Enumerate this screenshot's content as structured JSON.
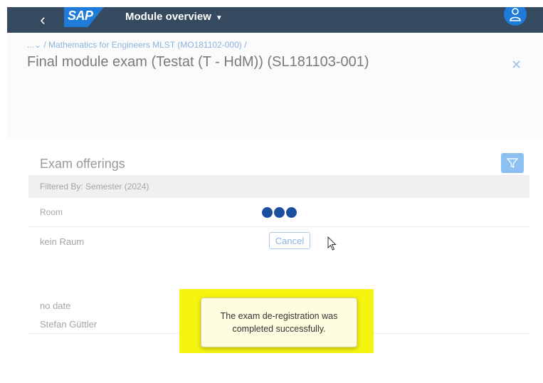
{
  "shell": {
    "back_icon": "chevron-left-icon",
    "logo_text": "SAP",
    "title": "Module overview",
    "title_caret": "▼",
    "avatar_icon": "user-icon",
    "brand_color": "#354a5f",
    "accent_color": "#1e7bd8"
  },
  "header": {
    "breadcrumb_prefix": "...⌄ /",
    "breadcrumb_link": "Mathematics for Engineers MLST (MO181102-000)",
    "breadcrumb_suffix": "/",
    "title": "Final module exam (Testat (T - HdM)) (SL181103-001)",
    "close_symbol": "✕"
  },
  "offerings": {
    "title": "Exam offerings",
    "filter_icon": "filter-icon",
    "filter_text": "Filtered By: Semester (2024)",
    "column_room": "Room",
    "busy_indicator": "loading-dots",
    "row": {
      "room": "kein Raum",
      "cancel_label": "Cancel",
      "date": "no date",
      "person": "Stefan Güttler"
    }
  },
  "toast": {
    "message": "The exam de-registration was completed successfully.",
    "highlight_color": "#f4f410"
  }
}
